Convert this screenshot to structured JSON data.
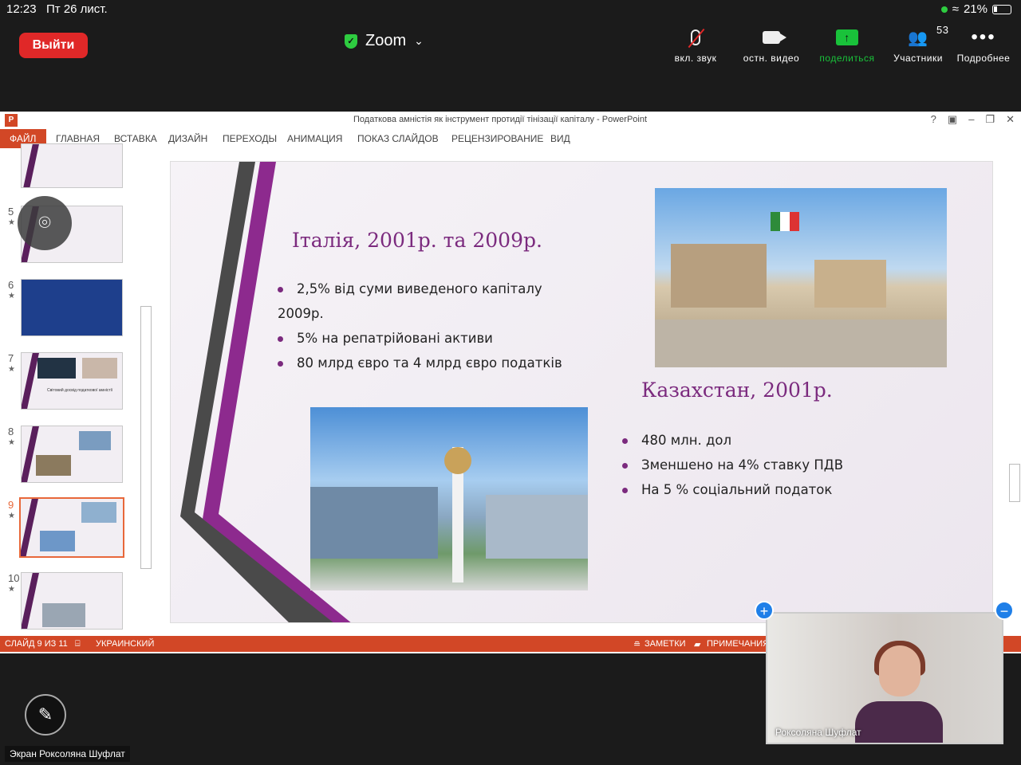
{
  "status": {
    "time": "12:23",
    "date": "Пт 26 лист.",
    "battery": "21%"
  },
  "zoom": {
    "leave_label": "Выйти",
    "title": "Zoom",
    "controls": {
      "audio_label": "вкл. звук",
      "video_label": "остн. видео",
      "share_label": "поделиться",
      "participants_label": "Участники",
      "participants_count": "53",
      "more_label": "Подробнее"
    },
    "presenter_label": "Экран Роксоляна Шуфлат",
    "video_name": "Роксоляна Шуфлат"
  },
  "powerpoint": {
    "window_title": "Податкова амністія як інструмент протидії тінізації капіталу - PowerPoint",
    "ribbon_tabs": [
      "ФАЙЛ",
      "ГЛАВНАЯ",
      "ВСТАВКА",
      "ДИЗАЙН",
      "ПЕРЕХОДЫ",
      "АНИМАЦИЯ",
      "ПОКАЗ СЛАЙДОВ",
      "РЕЦЕНЗИРОВАНИЕ",
      "ВИД"
    ],
    "thumbnails": [
      {
        "num": "5"
      },
      {
        "num": "6"
      },
      {
        "num": "7"
      },
      {
        "num": "8"
      },
      {
        "num": "9"
      },
      {
        "num": "10"
      }
    ],
    "thumb7_caption": "Світовий досвід податкової амністії",
    "status": {
      "slide": "СЛАЙД 9 ИЗ 11",
      "language": "УКРАИНСКИЙ",
      "notes": "ЗАМЕТКИ",
      "comments": "ПРИМЕЧАНИЯ"
    }
  },
  "slide": {
    "italy_title": "Італія, 2001р. та 2009р.",
    "italy_bullets": [
      "2,5% від суми виведеного капіталу",
      "2009р.",
      "5% на репатрійовані активи",
      "80 млрд євро та 4 млрд євро податків"
    ],
    "kz_title": "Казахстан, 2001р.",
    "kz_bullets": [
      "480 млн. дол",
      "Зменшено на 4% ставку ПДВ",
      "На 5 % соціальний податок"
    ]
  },
  "colors": {
    "accent": "#7b2a7e",
    "pp_red": "#d24726",
    "zoom_green": "#19c23a",
    "leave_red": "#e02828"
  },
  "icons": [
    "mic-muted-icon",
    "video-camera-icon",
    "share-screen-icon",
    "participants-icon",
    "more-icon",
    "pen-icon",
    "camera-flip-icon",
    "shield-check-icon"
  ]
}
